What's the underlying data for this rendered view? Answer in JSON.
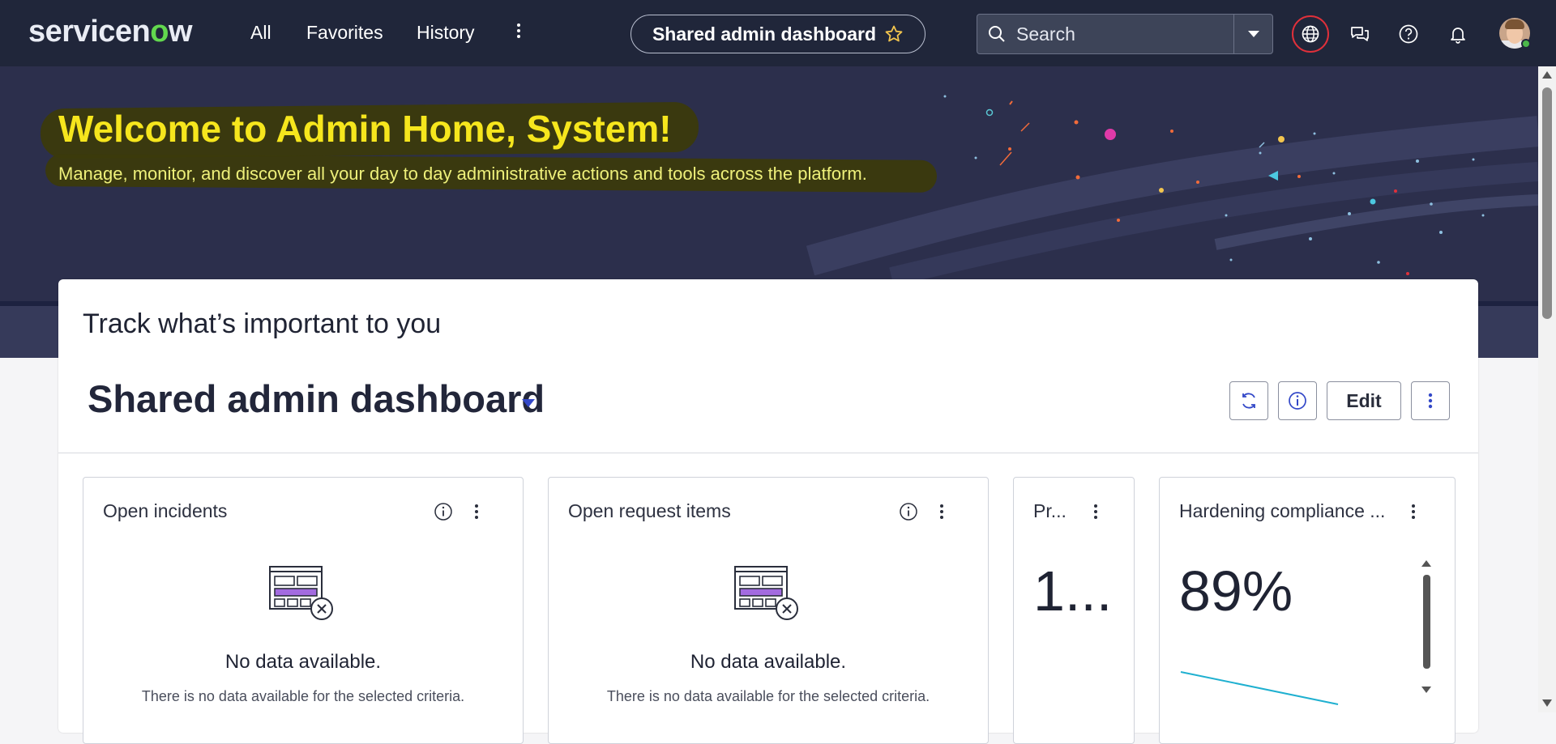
{
  "app": {
    "logo_text": "servicenow",
    "logo_accent_color": "#62d84e"
  },
  "nav": {
    "links": [
      "All",
      "Favorites",
      "History"
    ],
    "more_icon": "kebab-icon",
    "context_title": "Shared admin dashboard",
    "context_favorite_icon": "star-icon",
    "search": {
      "placeholder": "Search",
      "icon": "search-icon",
      "dropdown_icon": "chevron-down-icon"
    },
    "icons": [
      "globe-icon",
      "chat-icon",
      "help-icon",
      "bell-icon"
    ],
    "avatar_status": "online"
  },
  "hero": {
    "title": "Welcome to Admin Home, System!",
    "subtitle": "Manage, monitor, and discover all your day to day administrative actions and tools across the platform."
  },
  "dashboard": {
    "heading": "Track what’s important to you",
    "title": "Shared admin dashboard",
    "actions": {
      "refresh_icon": "refresh-icon",
      "info_icon": "info-icon",
      "edit_label": "Edit",
      "more_icon": "kebab-icon"
    },
    "widgets": [
      {
        "title": "Open incidents",
        "empty_title": "No data available.",
        "empty_text": "There is no data available for the selected criteria."
      },
      {
        "title": "Open request items",
        "empty_title": "No data available.",
        "empty_text": "There is no data available for the selected criteria."
      },
      {
        "title": "Pr...",
        "value": "1..."
      },
      {
        "title": "Hardening compliance ...",
        "value": "89%"
      }
    ]
  },
  "colors": {
    "nav_bg": "#20263a",
    "hero_bg": "#2c2f4c",
    "hero_title": "#f6e61d",
    "accent_blue": "#3348c8",
    "globe_ring": "#e0303a"
  }
}
